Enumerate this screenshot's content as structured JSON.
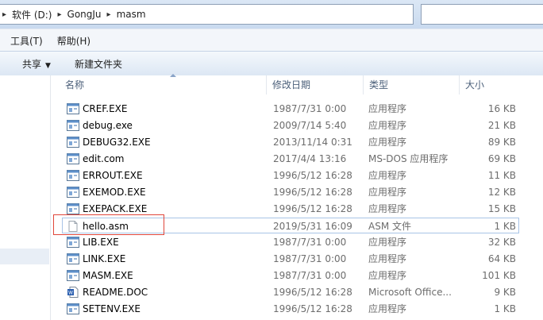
{
  "address": {
    "crumbs": [
      "软件 (D:)",
      "GongJu",
      "masm"
    ]
  },
  "menu": [
    "工具(T)",
    "帮助(H)"
  ],
  "toolbar": {
    "share_label": "共享",
    "new_folder_label": "新建文件夹"
  },
  "columns": {
    "name": "名称",
    "date": "修改日期",
    "type": "类型",
    "size": "大小"
  },
  "files": [
    {
      "name": "CREF.EXE",
      "date": "1987/7/31 0:00",
      "type": "应用程序",
      "size": "16 KB",
      "icon": "exe-icon"
    },
    {
      "name": "debug.exe",
      "date": "2009/7/14 5:40",
      "type": "应用程序",
      "size": "21 KB",
      "icon": "exe-icon"
    },
    {
      "name": "DEBUG32.EXE",
      "date": "2013/11/14 0:31",
      "type": "应用程序",
      "size": "89 KB",
      "icon": "exe-icon"
    },
    {
      "name": "edit.com",
      "date": "2017/4/4 13:16",
      "type": "MS-DOS 应用程序",
      "size": "69 KB",
      "icon": "exe-icon"
    },
    {
      "name": "ERROUT.EXE",
      "date": "1996/5/12 16:28",
      "type": "应用程序",
      "size": "11 KB",
      "icon": "exe-icon"
    },
    {
      "name": "EXEMOD.EXE",
      "date": "1996/5/12 16:28",
      "type": "应用程序",
      "size": "12 KB",
      "icon": "exe-icon"
    },
    {
      "name": "EXEPACK.EXE",
      "date": "1996/5/12 16:28",
      "type": "应用程序",
      "size": "15 KB",
      "icon": "exe-icon"
    },
    {
      "name": "hello.asm",
      "date": "2019/5/31 16:09",
      "type": "ASM 文件",
      "size": "1 KB",
      "icon": "file-icon"
    },
    {
      "name": "LIB.EXE",
      "date": "1987/7/31 0:00",
      "type": "应用程序",
      "size": "32 KB",
      "icon": "exe-icon"
    },
    {
      "name": "LINK.EXE",
      "date": "1987/7/31 0:00",
      "type": "应用程序",
      "size": "64 KB",
      "icon": "exe-icon"
    },
    {
      "name": "MASM.EXE",
      "date": "1987/7/31 0:00",
      "type": "应用程序",
      "size": "101 KB",
      "icon": "exe-icon"
    },
    {
      "name": "README.DOC",
      "date": "1996/5/12 16:28",
      "type": "Microsoft Office...",
      "size": "9 KB",
      "icon": "word-doc-icon"
    },
    {
      "name": "SETENV.EXE",
      "date": "1996/5/12 16:28",
      "type": "应用程序",
      "size": "1 KB",
      "icon": "exe-icon"
    }
  ],
  "colors": {
    "selection_border": "#a8c4e6",
    "annotation_red": "#e0463a"
  }
}
